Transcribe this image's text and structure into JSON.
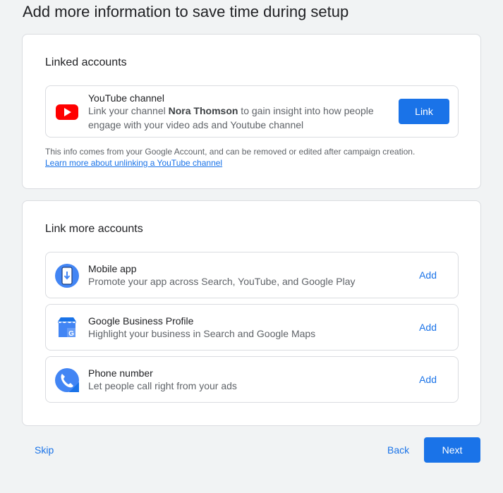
{
  "page": {
    "title": "Add more information to save time during setup"
  },
  "linked_accounts": {
    "title": "Linked accounts",
    "youtube": {
      "title": "YouTube channel",
      "desc_prefix": "Link your channel ",
      "channel_name": "Nora Thomson",
      "desc_suffix": " to gain insight into how people engage with your video ads and Youtube channel",
      "button_label": "Link",
      "icon": "youtube-icon"
    },
    "info_text": "This info comes from your Google Account, and can be removed or edited after campaign creation.",
    "learn_more_link": "Learn more about unlinking a YouTube channel"
  },
  "link_more": {
    "title": "Link more accounts",
    "items": [
      {
        "title": "Mobile app",
        "desc": "Promote your app across Search, YouTube, and Google Play",
        "action": "Add",
        "icon": "mobile-app-icon"
      },
      {
        "title": "Google Business Profile",
        "desc": "Highlight your business in Search and Google Maps",
        "action": "Add",
        "icon": "business-profile-icon"
      },
      {
        "title": "Phone number",
        "desc": "Let people call right from your ads",
        "action": "Add",
        "icon": "phone-icon"
      }
    ]
  },
  "footer": {
    "skip_label": "Skip",
    "back_label": "Back",
    "next_label": "Next"
  },
  "colors": {
    "accent": "#1a73e8",
    "youtube_red": "#ff0000",
    "background": "#f1f3f4"
  }
}
